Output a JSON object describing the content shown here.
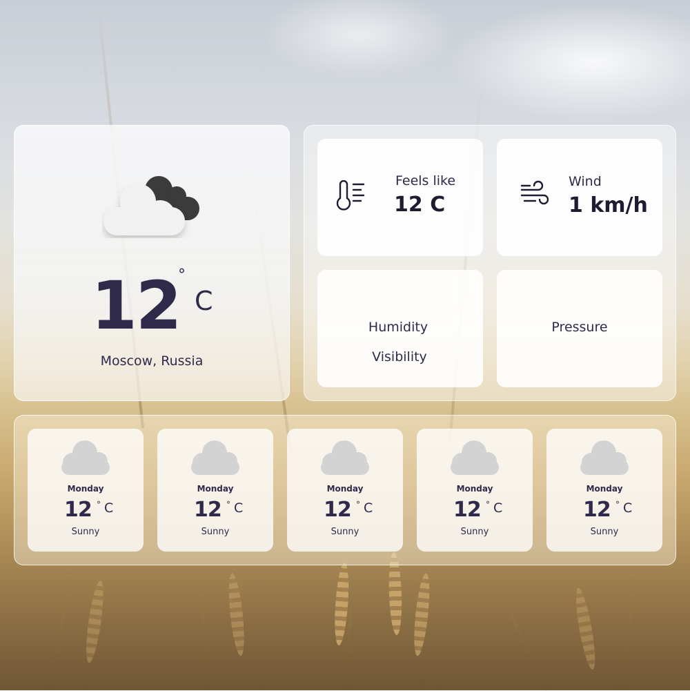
{
  "current": {
    "icon": "cloudy-icon",
    "temperature": "12",
    "degree_symbol": "°",
    "unit": "C",
    "location": "Moscow, Russia"
  },
  "details": {
    "feels_like": {
      "icon": "thermometer-icon",
      "label": "Feels like",
      "value": "12 C"
    },
    "wind": {
      "icon": "wind-icon",
      "label": "Wind",
      "value": "1 km/h"
    },
    "humidity": {
      "label": "Humidity"
    },
    "visibility": {
      "label": "Visibility"
    },
    "pressure": {
      "label": "Pressure"
    }
  },
  "forecast": [
    {
      "icon": "cloud-icon",
      "day": "Monday",
      "temperature": "12",
      "degree_symbol": "°",
      "unit": "C",
      "condition": "Sunny"
    },
    {
      "icon": "cloud-icon",
      "day": "Monday",
      "temperature": "12",
      "degree_symbol": "°",
      "unit": "C",
      "condition": "Sunny"
    },
    {
      "icon": "cloud-icon",
      "day": "Monday",
      "temperature": "12",
      "degree_symbol": "°",
      "unit": "C",
      "condition": "Sunny"
    },
    {
      "icon": "cloud-icon",
      "day": "Monday",
      "temperature": "12",
      "degree_symbol": "°",
      "unit": "C",
      "condition": "Sunny"
    },
    {
      "icon": "cloud-icon",
      "day": "Monday",
      "temperature": "12",
      "degree_symbol": "°",
      "unit": "C",
      "condition": "Sunny"
    }
  ],
  "colors": {
    "text_primary": "#2f2a4a",
    "text_value": "#1f1b30",
    "cloud_light": "#f1f1f1",
    "cloud_dark": "#3b3b3b",
    "forecast_cloud": "#d3d3d3"
  }
}
